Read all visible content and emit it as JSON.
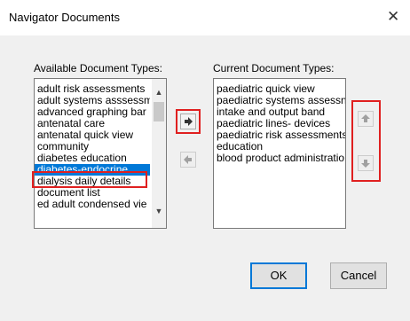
{
  "dialog": {
    "title": "Navigator Documents",
    "close_glyph": "✕"
  },
  "available": {
    "label": "Available Document Types:",
    "items": [
      "adult risk assessments",
      "adult systems asssessm",
      "advanced graphing bar",
      "antenatal care",
      "antenatal quick view",
      "community",
      "diabetes education",
      "diabetes-endocrine",
      "dialysis daily details",
      "document list",
      "ed adult condensed vie"
    ],
    "selected_index": 7,
    "scroll_up": "▲",
    "scroll_down": "▼"
  },
  "current": {
    "label": "Current Document Types:",
    "items": [
      "paediatric quick view",
      "paediatric systems assessn",
      "intake and output band",
      "paediatric lines- devices",
      "paediatric risk assessments",
      "education",
      "blood product administratio"
    ]
  },
  "buttons": {
    "ok": "OK",
    "cancel": "Cancel"
  },
  "icons": {
    "add_arrow": "right-arrow-icon",
    "remove_arrow": "left-arrow-icon",
    "move_up": "up-arrow-icon",
    "move_down": "down-arrow-icon"
  },
  "colors": {
    "selection": "#0078d7",
    "highlight_box": "#e02020",
    "dialog_bg": "#f0f0f0"
  }
}
